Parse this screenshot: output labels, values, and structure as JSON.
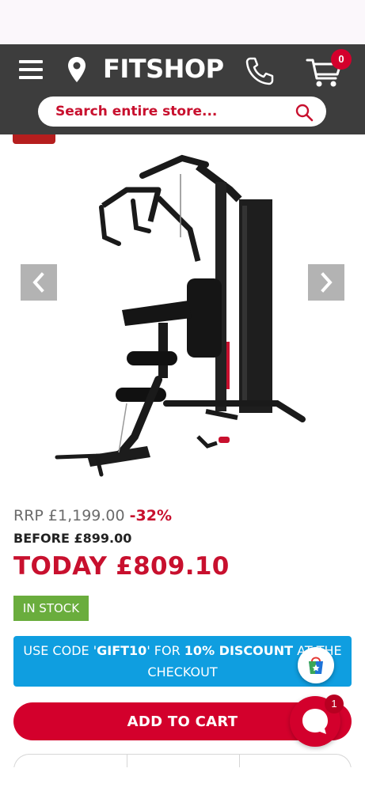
{
  "header": {
    "logo": "FITSHOP",
    "cart_count": "0"
  },
  "search": {
    "placeholder": "Search entire store..."
  },
  "product": {
    "rrp_label": "RRP £1,199.00",
    "discount": "-32%",
    "before_price": "BEFORE £899.00",
    "today_price": "TODAY £809.10",
    "stock_status": "IN STOCK"
  },
  "promo": {
    "prefix": "USE CODE '",
    "code": "GIFT10",
    "middle": "' FOR ",
    "discount": "10% DISCOUNT",
    "suffix": " AT THE CHECKOUT"
  },
  "actions": {
    "add_to_cart": "ADD TO CART"
  },
  "chat": {
    "badge_count": "1"
  },
  "colors": {
    "brand_red": "#d3002c",
    "header_bg": "#3d3d3d",
    "stock_green": "#6aad3d",
    "promo_blue": "#0f9ee0"
  }
}
